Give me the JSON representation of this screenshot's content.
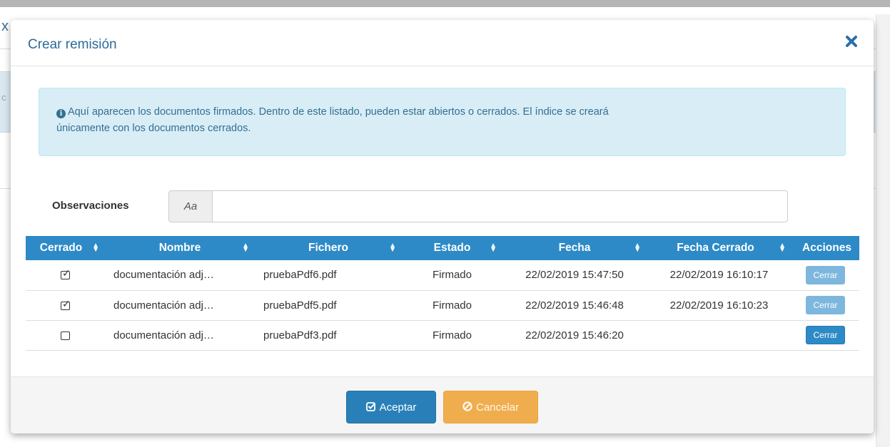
{
  "background": {
    "title_fragment": "x",
    "band_fragment": "c"
  },
  "modal": {
    "title": "Crear remisión",
    "close_icon": "×",
    "alert_text": "Aquí aparecen los documentos firmados. Dentro de este listado, pueden estar abiertos o cerrados. El índice se creará",
    "alert_text_2": "únicamente con los documentos cerrados.",
    "observaciones": {
      "label": "Observaciones",
      "addon": "Aa",
      "value": ""
    },
    "table": {
      "headers": [
        "Cerrado",
        "Nombre",
        "Fichero",
        "Estado",
        "Fecha",
        "Fecha Cerrado",
        "Acciones"
      ],
      "rows": [
        {
          "cerrado": true,
          "nombre": "documentación adj…",
          "fichero": "pruebaPdf6.pdf",
          "estado": "Firmado",
          "fecha": "22/02/2019 15:47:50",
          "fecha_cerrado": "22/02/2019 16:10:17",
          "accion": "Cerrar",
          "accion_enabled": false
        },
        {
          "cerrado": true,
          "nombre": "documentación adj…",
          "fichero": "pruebaPdf5.pdf",
          "estado": "Firmado",
          "fecha": "22/02/2019 15:46:48",
          "fecha_cerrado": "22/02/2019 16:10:23",
          "accion": "Cerrar",
          "accion_enabled": false
        },
        {
          "cerrado": false,
          "nombre": "documentación adj…",
          "fichero": "pruebaPdf3.pdf",
          "estado": "Firmado",
          "fecha": "22/02/2019 15:46:20",
          "fecha_cerrado": "",
          "accion": "Cerrar",
          "accion_enabled": true
        }
      ]
    },
    "footer": {
      "accept_label": "Aceptar",
      "cancel_label": "Cancelar"
    }
  },
  "colors": {
    "primary": "#2d8ac7",
    "warning": "#f0ad4e",
    "info_bg": "#d9edf7",
    "info_text": "#31708f"
  }
}
